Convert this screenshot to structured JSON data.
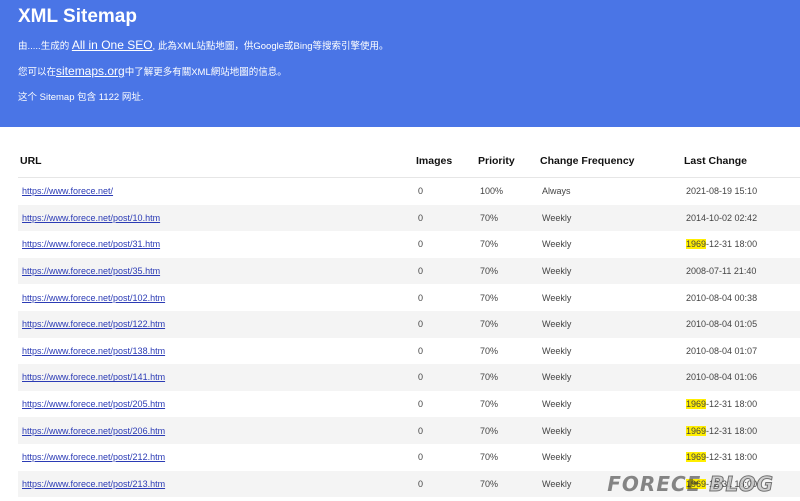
{
  "header": {
    "title": "XML Sitemap",
    "line1_pre": "由.....生成的 ",
    "line1_link": "All in One SEO",
    "line1_post": ", 此為XML站點地圖，供Google或Bing等搜索引擎使用。",
    "line2_pre": "您可以在",
    "line2_link": "sitemaps.org",
    "line2_post": "中了解更多有關XML網站地圖的信息。",
    "line3": "这个 Sitemap 包含 1122 网址."
  },
  "table": {
    "columns": [
      "URL",
      "Images",
      "Priority",
      "Change Frequency",
      "Last Change"
    ],
    "rows": [
      {
        "url": "https://www.forece.net/",
        "images": "0",
        "priority": "100%",
        "freq": "Always",
        "year": "2021",
        "date_rest": "-08-19 15:10",
        "hl": false
      },
      {
        "url": "https://www.forece.net/post/10.htm",
        "images": "0",
        "priority": "70%",
        "freq": "Weekly",
        "year": "2014",
        "date_rest": "-10-02 02:42",
        "hl": false
      },
      {
        "url": "https://www.forece.net/post/31.htm",
        "images": "0",
        "priority": "70%",
        "freq": "Weekly",
        "year": "1969",
        "date_rest": "-12-31 18:00",
        "hl": true
      },
      {
        "url": "https://www.forece.net/post/35.htm",
        "images": "0",
        "priority": "70%",
        "freq": "Weekly",
        "year": "2008",
        "date_rest": "-07-11 21:40",
        "hl": false
      },
      {
        "url": "https://www.forece.net/post/102.htm",
        "images": "0",
        "priority": "70%",
        "freq": "Weekly",
        "year": "2010",
        "date_rest": "-08-04 00:38",
        "hl": false
      },
      {
        "url": "https://www.forece.net/post/122.htm",
        "images": "0",
        "priority": "70%",
        "freq": "Weekly",
        "year": "2010",
        "date_rest": "-08-04 01:05",
        "hl": false
      },
      {
        "url": "https://www.forece.net/post/138.htm",
        "images": "0",
        "priority": "70%",
        "freq": "Weekly",
        "year": "2010",
        "date_rest": "-08-04 01:07",
        "hl": false
      },
      {
        "url": "https://www.forece.net/post/141.htm",
        "images": "0",
        "priority": "70%",
        "freq": "Weekly",
        "year": "2010",
        "date_rest": "-08-04 01:06",
        "hl": false
      },
      {
        "url": "https://www.forece.net/post/205.htm",
        "images": "0",
        "priority": "70%",
        "freq": "Weekly",
        "year": "1969",
        "date_rest": "-12-31 18:00",
        "hl": true
      },
      {
        "url": "https://www.forece.net/post/206.htm",
        "images": "0",
        "priority": "70%",
        "freq": "Weekly",
        "year": "1969",
        "date_rest": "-12-31 18:00",
        "hl": true
      },
      {
        "url": "https://www.forece.net/post/212.htm",
        "images": "0",
        "priority": "70%",
        "freq": "Weekly",
        "year": "1969",
        "date_rest": "-12-31 18:00",
        "hl": true
      },
      {
        "url": "https://www.forece.net/post/213.htm",
        "images": "0",
        "priority": "70%",
        "freq": "Weekly",
        "year": "1969",
        "date_rest": "-12-31 18:00",
        "hl": true
      }
    ]
  },
  "watermark": {
    "part1": "FORECE",
    "part2": " BLOG"
  },
  "colors": {
    "header_bg": "#4a75e6",
    "highlight": "#ffee00",
    "link": "#2b3bb5"
  }
}
